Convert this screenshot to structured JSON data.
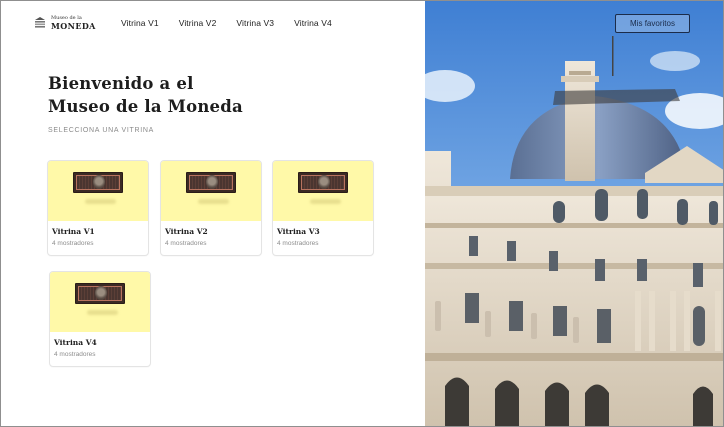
{
  "header": {
    "logo_small": "Museo de la",
    "logo_big": "MONEDA",
    "nav": [
      {
        "label": "Vitrina V1"
      },
      {
        "label": "Vitrina V2"
      },
      {
        "label": "Vitrina V3"
      },
      {
        "label": "Vitrina V4"
      }
    ],
    "favorites_label": "Mis favoritos"
  },
  "hero": {
    "title_line1": "Bienvenido a el",
    "title_line2": "Museo de la Moneda",
    "subtitle": "SELECCIONA UNA VITRINA"
  },
  "cards": [
    {
      "title": "Vitrina V1",
      "subtitle": "4 mostradores"
    },
    {
      "title": "Vitrina V2",
      "subtitle": "4 mostradores"
    },
    {
      "title": "Vitrina V3",
      "subtitle": "4 mostradores"
    },
    {
      "title": "Vitrina V4",
      "subtitle": "4 mostradores"
    }
  ],
  "colors": {
    "card_thumb_bg": "#fff9a8",
    "button_border": "#1b2c4a",
    "sky": "#5c8fd6"
  }
}
